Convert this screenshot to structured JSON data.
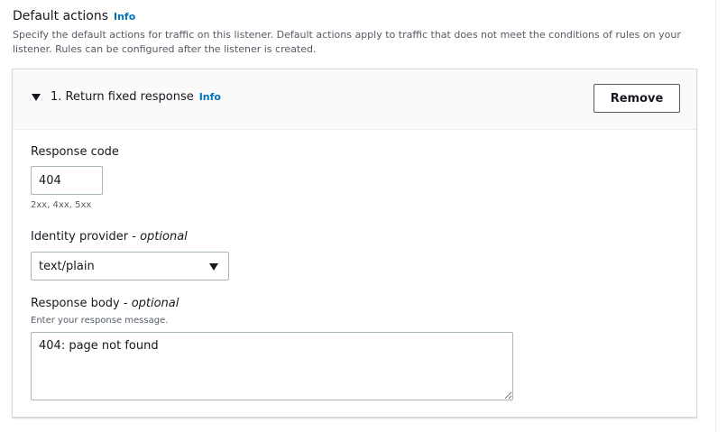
{
  "section": {
    "title": "Default actions",
    "info": "Info",
    "description": "Specify the default actions for traffic on this listener. Default actions apply to traffic that does not meet the conditions of rules on your listener. Rules can be configured after the listener is created."
  },
  "action": {
    "title": "1. Return fixed response",
    "info": "Info",
    "remove_label": "Remove",
    "expand_icon": "caret-down-icon"
  },
  "response_code": {
    "label": "Response code",
    "value": "404",
    "hint": "2xx, 4xx, 5xx"
  },
  "content_type": {
    "label": "Identity provider",
    "label_suffix": "optional",
    "selected": "text/plain",
    "icon": "caret-down-icon"
  },
  "response_body": {
    "label": "Response body",
    "label_suffix": "optional",
    "hint": "Enter your response message.",
    "value": "404: page not found"
  },
  "colors": {
    "link": "#0073bb",
    "text": "#16191f",
    "muted": "#545b64",
    "border": "#aab7b8",
    "header_bg": "#fafafa"
  }
}
